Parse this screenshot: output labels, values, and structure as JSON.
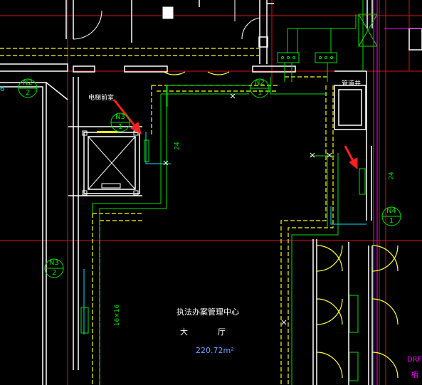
{
  "canvas": {
    "background": "#000000"
  },
  "colors": {
    "wall": "#ffffff",
    "grid": "#e0101a",
    "pipe_green": "#00e000",
    "pipe_yellow": "#ffff00",
    "magenta": "#ff00ff",
    "cyan": "#00e0ff",
    "door_yellow": "#ffff40",
    "arrow": "#ff2020",
    "area_blue": "#6fa0ff"
  },
  "labels": {
    "elevator_room": "电梯前室",
    "pipe_well": "管道井",
    "room_name": "执法办案管理中心",
    "room_type_1": "大",
    "room_type_2": "厅",
    "room_area": "220.72m²",
    "dim_24_left": "24",
    "dim_24_right": "24",
    "dim_16": "16×16",
    "cut_text": "DRF",
    "side_text": "植",
    "right_partial": "6"
  },
  "markers": [
    {
      "id": "N2",
      "num": "2"
    },
    {
      "id": "N2",
      "num": "1"
    },
    {
      "id": "N3",
      "num": "1"
    },
    {
      "id": "N3",
      "num": "2"
    },
    {
      "id": "N4",
      "num": "1"
    }
  ],
  "icons": [
    "red-arrow-icon",
    "elevator-icon",
    "valve-icon",
    "door-swing-icon"
  ]
}
